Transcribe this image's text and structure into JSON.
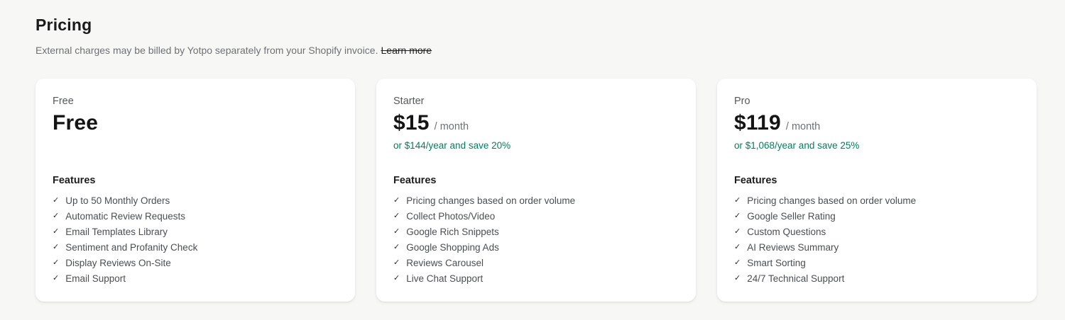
{
  "header": {
    "title": "Pricing",
    "subtitle": "External charges may be billed by Yotpo separately from your Shopify invoice.",
    "learn_more_label": "Learn more"
  },
  "check_icon": "✓",
  "colors": {
    "background": "#f7f7f6",
    "card_background": "#ffffff",
    "accent_green": "#008060",
    "text_primary": "#1a1a1a",
    "text_secondary": "#6d7175"
  },
  "plans": [
    {
      "name": "Free",
      "price": "Free",
      "period": "",
      "annual_note": "",
      "features_heading": "Features",
      "features": [
        "Up to 50 Monthly Orders",
        "Automatic Review Requests",
        "Email Templates Library",
        "Sentiment and Profanity Check",
        "Display Reviews On-Site",
        "Email Support"
      ]
    },
    {
      "name": "Starter",
      "price": "$15",
      "period": "/ month",
      "annual_note": "or $144/year and save 20%",
      "features_heading": "Features",
      "features": [
        "Pricing changes based on order volume",
        "Collect Photos/Video",
        "Google Rich Snippets",
        "Google Shopping Ads",
        "Reviews Carousel",
        "Live Chat Support"
      ]
    },
    {
      "name": "Pro",
      "price": "$119",
      "period": "/ month",
      "annual_note": "or $1,068/year and save 25%",
      "features_heading": "Features",
      "features": [
        "Pricing changes based on order volume",
        "Google Seller Rating",
        "Custom Questions",
        "AI Reviews Summary",
        "Smart Sorting",
        "24/7 Technical Support"
      ]
    }
  ]
}
